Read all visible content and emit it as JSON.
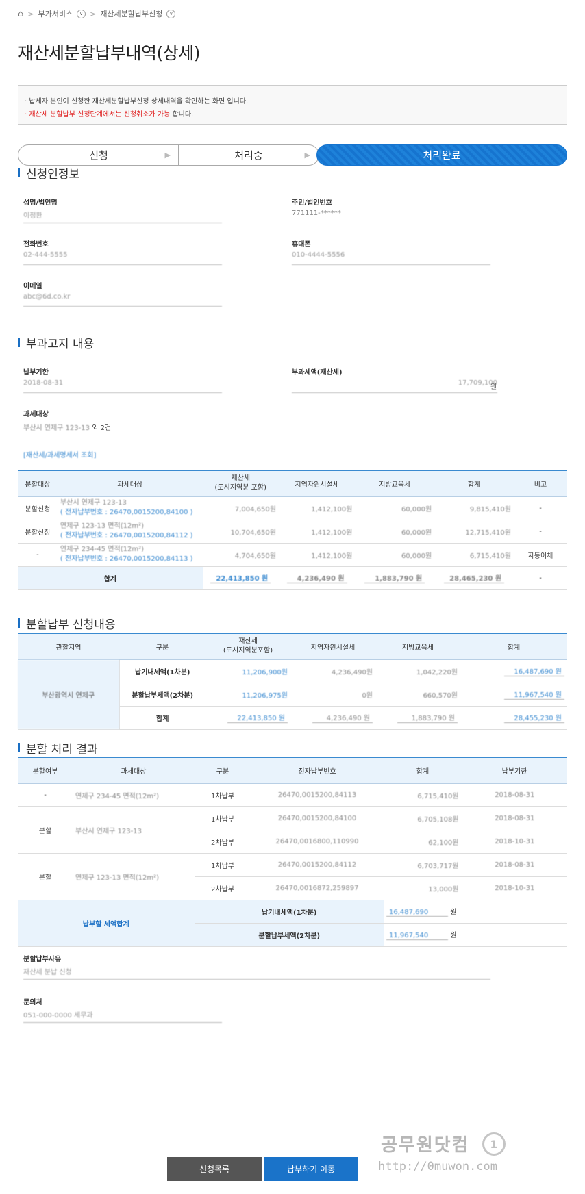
{
  "breadcrumb": {
    "home_icon": "home-icon",
    "item1": "부가서비스",
    "item2": "재산세분할납부신청"
  },
  "title": "재산세분할납부내역(상세)",
  "notice": {
    "line1": "· 납세자 본인이 신청한 재산세분할납부신청 상세내역을 확인하는 화면 입니다.",
    "line2_red": "· 재산세 분할납부 신청단계에서는 신청취소가 가능",
    "line2_rest": " 합니다."
  },
  "steps": [
    "신청",
    "처리중",
    "처리완료"
  ],
  "applicant": {
    "title": "신청인정보",
    "name_label": "성명/법인명",
    "name_value": "이정환",
    "id_label": "주민/법인번호",
    "id_value": "771111-******",
    "phone_label": "전화번호",
    "phone_value": "02-444-5555",
    "mobile_label": "휴대폰",
    "mobile_value": "010-4444-5556",
    "email_label": "이메일",
    "email_value": "abc@6d.co.kr"
  },
  "notice_section": {
    "title": "부과고지 내용",
    "due_label": "납부기한",
    "due_value": "2018-08-31",
    "tax_label": "부과세액(재산세)",
    "tax_value": "17,709,100",
    "tax_unit": "원",
    "target_label": "과세대상",
    "target_value": "부산시 연제구 123-13",
    "target_more": "외 2건",
    "link": "[재산세/과세명세서 조회]"
  },
  "table1": {
    "headers": [
      "분할대상",
      "과세대상",
      "재산세\n(도시지역분 포함)",
      "지역자원시설세",
      "지방교육세",
      "합계",
      "비고"
    ],
    "rows": [
      {
        "type": "분할신청",
        "target": "부산시 연제구 123-13",
        "elec": "( 전자납부번호 : 26470,0015200,84100 )",
        "prop": "7,004,650원",
        "res": "1,412,100원",
        "edu": "60,000원",
        "sum": "9,815,410원",
        "note": "-"
      },
      {
        "type": "분할신청",
        "target": "연제구 123-13 면적(12m²)",
        "elec": "( 전자납부번호 : 26470,0015200,84112 )",
        "prop": "10,704,650원",
        "res": "1,412,100원",
        "edu": "60,000원",
        "sum": "12,715,410원",
        "note": "-"
      },
      {
        "type": "-",
        "target": "연제구 234-45 면적(12m²)",
        "elec": "( 전자납부번호 : 26470,0015200,84113 )",
        "prop": "4,704,650원",
        "res": "1,412,100원",
        "edu": "60,000원",
        "sum": "6,715,410원",
        "note": "자동이체"
      }
    ],
    "total_label": "합계",
    "total_prop": "22,413,850",
    "total_res": "4,236,490",
    "total_edu": "1,883,790",
    "total_sum": "28,465,230",
    "unit": "원",
    "total_note": "-"
  },
  "split_apply": {
    "title": "분할납부 신청내용",
    "headers": [
      "관할지역",
      "구분",
      "재산세\n(도시지역분포함)",
      "지역자원시설세",
      "지방교육세",
      "합계"
    ],
    "region": "부산광역시 연제구",
    "rows": [
      {
        "label": "납기내세액(1차분)",
        "prop": "11,206,900원",
        "res": "4,236,490원",
        "edu": "1,042,220원",
        "sum": "16,487,690"
      },
      {
        "label": "분할납부세액(2차분)",
        "prop": "11,206,975원",
        "res": "0원",
        "edu": "660,570원",
        "sum": "11,967,540"
      }
    ],
    "total_label": "합계",
    "total_prop": "22,413,850",
    "total_res": "4,236,490",
    "total_edu": "1,883,790",
    "total_sum": "28,455,230",
    "unit": "원"
  },
  "result": {
    "title": "분할 처리 결과",
    "headers": [
      "분할여부",
      "과세대상",
      "구분",
      "전자납부번호",
      "합계",
      "납부기한"
    ],
    "groups": [
      {
        "split": "-",
        "target": "연제구 234-45 면적(12m²)",
        "rows": [
          {
            "kind": "1차납부",
            "elec": "26470,0015200,84113",
            "sum": "6,715,410원",
            "due": "2018-08-31"
          }
        ]
      },
      {
        "split": "분할",
        "target": "부산시 연제구 123-13",
        "rows": [
          {
            "kind": "1차납부",
            "elec": "26470,0015200,84100",
            "sum": "6,705,108원",
            "due": "2018-08-31"
          },
          {
            "kind": "2차납부",
            "elec": "26470,0016800,110990",
            "sum": "62,100원",
            "due": "2018-10-31"
          }
        ]
      },
      {
        "split": "분할",
        "target": "연제구 123-13 면적(12m²)",
        "rows": [
          {
            "kind": "1차납부",
            "elec": "26470,0015200,84112",
            "sum": "6,703,717원",
            "due": "2018-08-31"
          },
          {
            "kind": "2차납부",
            "elec": "26470,0016872,259897",
            "sum": "13,000원",
            "due": "2018-10-31"
          }
        ]
      }
    ],
    "sum_label": "납부할 세액합계",
    "sum1_label": "납기내세액(1차분)",
    "sum1_value": "16,487,690",
    "sum2_label": "분할납부세액(2차분)",
    "sum2_value": "11,967,540",
    "unit": "원"
  },
  "reason": {
    "label": "분할납부사유",
    "value": "재산세 분납 신청"
  },
  "contact": {
    "label": "문의처",
    "value": "051-000-0000 세무과"
  },
  "buttons": {
    "list": "신청목록",
    "pay": "납부하기 이동"
  },
  "watermark": {
    "line1": "공무원닷컴",
    "line2": "http://0muwon.com"
  }
}
